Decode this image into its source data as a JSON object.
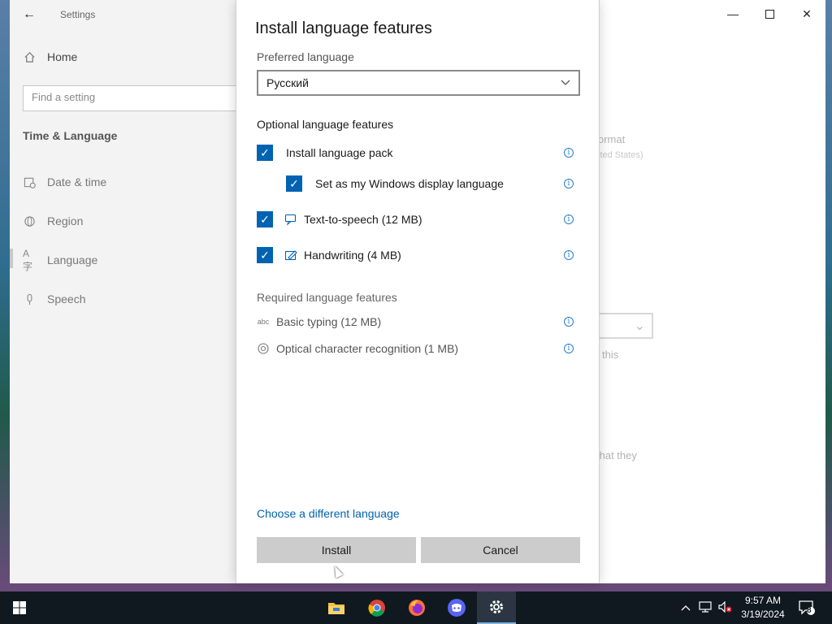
{
  "window": {
    "app_title": "Settings"
  },
  "sidebar": {
    "home_label": "Home",
    "search_placeholder": "Find a setting",
    "section_title": "Time & Language",
    "items": [
      {
        "label": "Date & time",
        "icon": "calendar-clock-icon"
      },
      {
        "label": "Region",
        "icon": "globe-icon"
      },
      {
        "label": "Language",
        "icon": "language-icon"
      },
      {
        "label": "Speech",
        "icon": "microphone-icon"
      }
    ]
  },
  "background": {
    "fragment_format": "ormat",
    "fragment_states": "ited States)",
    "fragment_this": "this",
    "fragment_that": "that they"
  },
  "dialog": {
    "title": "Install language features",
    "preferred_label": "Preferred language",
    "selected_language": "Русский",
    "optional_header": "Optional language features",
    "optional": [
      {
        "label": "Install language pack",
        "checked": true
      },
      {
        "label": "Set as my Windows display language",
        "checked": true
      },
      {
        "label": "Text-to-speech (12 MB)",
        "checked": true,
        "icon": "speech-icon"
      },
      {
        "label": "Handwriting (4 MB)",
        "checked": true,
        "icon": "pen-icon"
      }
    ],
    "required_header": "Required language features",
    "required": [
      {
        "label": "Basic typing (12 MB)",
        "icon": "abc-typing-icon"
      },
      {
        "label": "Optical character recognition (1 MB)",
        "icon": "ocr-icon"
      }
    ],
    "choose_link": "Choose a different language",
    "install_label": "Install",
    "cancel_label": "Cancel"
  },
  "taskbar": {
    "apps": [
      "file-explorer-icon",
      "chrome-icon",
      "firefox-icon",
      "discord-icon",
      "settings-gear-icon"
    ],
    "time": "9:57 AM",
    "date": "3/19/2024",
    "notification_count": "8"
  },
  "colors": {
    "accent": "#0063b1",
    "button_gray": "#cccccc",
    "taskbar": "#101820"
  }
}
